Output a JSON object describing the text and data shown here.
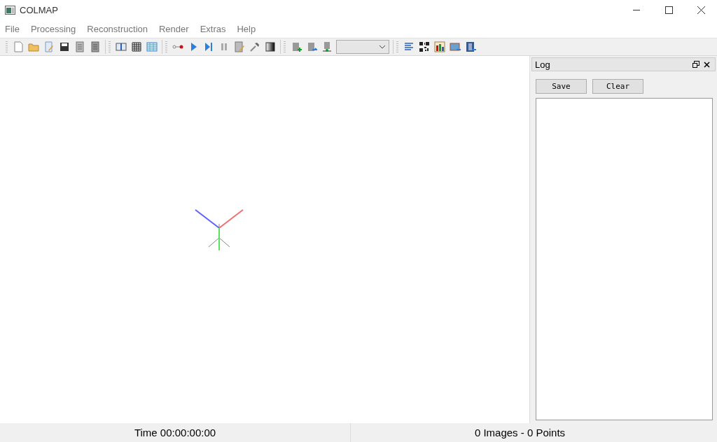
{
  "window": {
    "title": "COLMAP"
  },
  "menu": [
    "File",
    "Processing",
    "Reconstruction",
    "Render",
    "Extras",
    "Help"
  ],
  "log_dock": {
    "title": "Log",
    "buttons": [
      "Save",
      "Clear"
    ]
  },
  "status_bar": {
    "time": "Time 00:00:00:00",
    "counts": "0 Images - 0 Points"
  }
}
